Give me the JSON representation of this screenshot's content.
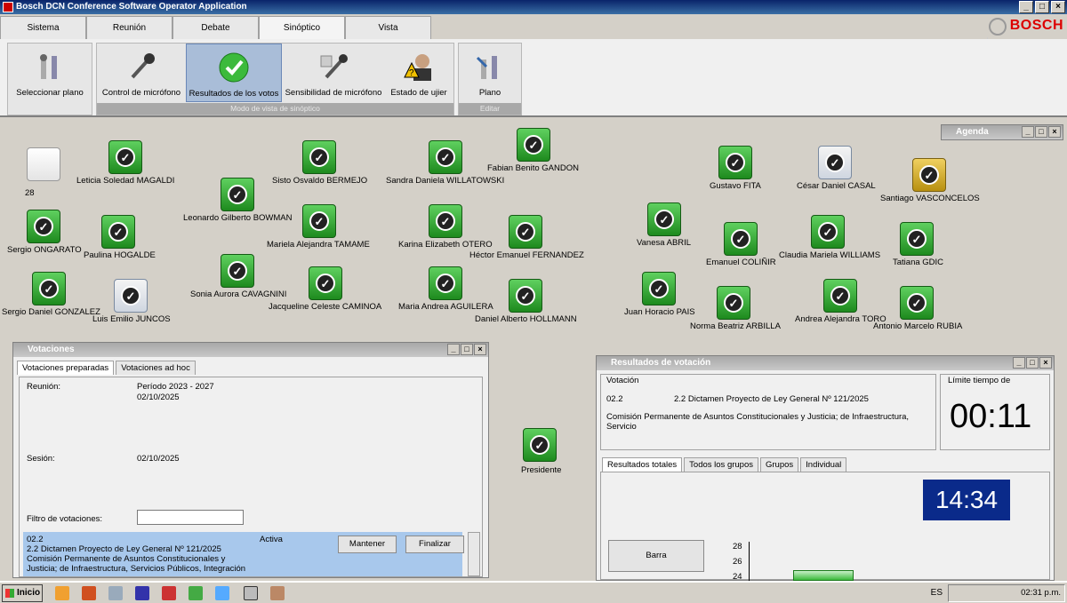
{
  "window": {
    "title": "Bosch DCN Conference Software Operator Application"
  },
  "brand": "BOSCH",
  "tabs": [
    "Sistema",
    "Reunión",
    "Debate",
    "Sinóptico",
    "Vista"
  ],
  "ribbon": {
    "select_plan": "Seleccionar plano",
    "mic_control": "Control de micrófono",
    "vote_results": "Resultados de los votos",
    "mic_sensitivity": "Sensibilidad de micrófono",
    "usher_state": "Estado de ujier",
    "group_label": "Modo de vista de sinóptico",
    "plan": "Plano",
    "edit_label": "Editar"
  },
  "seats": [
    {
      "name": "28",
      "status": "blank"
    },
    {
      "name": "Leticia Soledad MAGALDI",
      "status": "voted"
    },
    {
      "name": "Sisto Osvaldo BERMEJO",
      "status": "voted"
    },
    {
      "name": "Sandra Daniela WILLATOWSKI",
      "status": "voted"
    },
    {
      "name": "Fabian Benito GANDON",
      "status": "voted"
    },
    {
      "name": "Leonardo Gilberto BOWMAN",
      "status": "voted"
    },
    {
      "name": "Sergio ONGARATO",
      "status": "voted"
    },
    {
      "name": "Paulina HOGALDE",
      "status": "voted"
    },
    {
      "name": "Mariela Alejandra TAMAME",
      "status": "voted"
    },
    {
      "name": "Karina Elizabeth OTERO",
      "status": "voted"
    },
    {
      "name": "Héctor Emanuel FERNANDEZ",
      "status": "voted"
    },
    {
      "name": "Sonia Aurora CAVAGNINI",
      "status": "voted"
    },
    {
      "name": "Jacqueline Celeste CAMINOA",
      "status": "voted"
    },
    {
      "name": "Maria Andrea AGUILERA",
      "status": "voted"
    },
    {
      "name": "Daniel Alberto HOLLMANN",
      "status": "voted"
    },
    {
      "name": "Sergio Daniel GONZALEZ",
      "status": "voted"
    },
    {
      "name": "Luis Emilio JUNCOS",
      "status": "gray"
    },
    {
      "name": "Gustavo FITA",
      "status": "voted"
    },
    {
      "name": "César Daniel CASAL",
      "status": "gray"
    },
    {
      "name": "Santiago VASCONCELOS",
      "status": "yellow"
    },
    {
      "name": "Vanesa ABRIL",
      "status": "voted"
    },
    {
      "name": "Emanuel COLIÑIR",
      "status": "voted"
    },
    {
      "name": "Claudia Mariela WILLIAMS",
      "status": "voted"
    },
    {
      "name": "Tatiana GDIC",
      "status": "voted"
    },
    {
      "name": "Juan Horacio PAIS",
      "status": "voted"
    },
    {
      "name": "Norma Beatriz ARBILLA",
      "status": "voted"
    },
    {
      "name": "Andrea Alejandra TORO",
      "status": "voted"
    },
    {
      "name": "Antonio Marcelo RUBIA",
      "status": "voted"
    },
    {
      "name": "Presidente",
      "status": "voted"
    }
  ],
  "agenda": {
    "title": "Agenda"
  },
  "votaciones": {
    "title": "Votaciones",
    "tabs": [
      "Votaciones preparadas",
      "Votaciones ad hoc"
    ],
    "reunion_label": "Reunión:",
    "reunion_value1": "Período 2023 - 2027",
    "reunion_value2": "02/10/2025",
    "sesion_label": "Sesión:",
    "sesion_value": "02/10/2025",
    "filter_label": "Filtro de votaciones:",
    "filter_value": "",
    "item": {
      "code": "02.2",
      "line1": "2.2 Dictamen Proyecto de Ley General Nº 121/2025",
      "line2": "Comisión Permanente de Asuntos Constitucionales y",
      "line3": "Justicia; de Infraestructura, Servicios Públicos, Integración",
      "status": "Activa"
    },
    "btn_keep": "Mantener",
    "btn_finish": "Finalizar"
  },
  "resultados": {
    "title": "Resultados de votación",
    "group_label": "Votación",
    "code": "02.2",
    "text": "2.2 Dictamen Proyecto de Ley General Nº 121/2025",
    "text2": "Comisión Permanente de Asuntos Constitucionales y Justicia; de Infraestructura, Servicio",
    "limit_label": "Límite tiempo de",
    "limit_value": "00:11",
    "tabs": [
      "Resultados totales",
      "Todos los grupos",
      "Grupos",
      "Individual"
    ],
    "clock": "14:34",
    "bar_btn": "Barra",
    "axis_ticks": [
      "28",
      "26",
      "24"
    ]
  },
  "taskbar": {
    "start": "Inicio",
    "lang": "ES",
    "time": "02:31 p.m."
  }
}
